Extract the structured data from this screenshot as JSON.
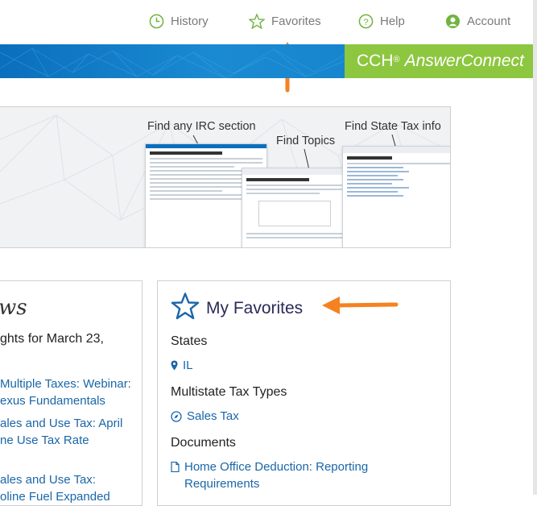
{
  "nav": {
    "history": "History",
    "favorites": "Favorites",
    "help": "Help",
    "account": "Account"
  },
  "brand": {
    "cch": "CCH",
    "reg": "®",
    "product": "AnswerConnect"
  },
  "hero": {
    "label_irc": "Find any IRC section",
    "label_topics": "Find Topics",
    "label_state": "Find State Tax info"
  },
  "news": {
    "title": "ws",
    "line1": "ghts for March 23,",
    "item1_line1": "Multiple Taxes: Webinar:",
    "item1_line2": "exus Fundamentals",
    "item2_line1": "ales and Use Tax: April",
    "item2_line2": "ne Use Tax Rate",
    "item3_line1": "ales and Use Tax:",
    "item3_line2": "oline Fuel Expanded"
  },
  "favorites": {
    "title": "My Favorites",
    "states_heading": "States",
    "state_item": "IL",
    "multistate_heading": "Multistate Tax Types",
    "multistate_item": "Sales Tax",
    "documents_heading": "Documents",
    "doc_line1": "Home Office Deduction: Reporting",
    "doc_line2": "Requirements"
  },
  "colors": {
    "brand_blue": "#0a6fbd",
    "brand_green": "#8dc63f",
    "arrow_orange": "#f58220",
    "link": "#1a66a8",
    "nav_green": "#6fb43f"
  }
}
